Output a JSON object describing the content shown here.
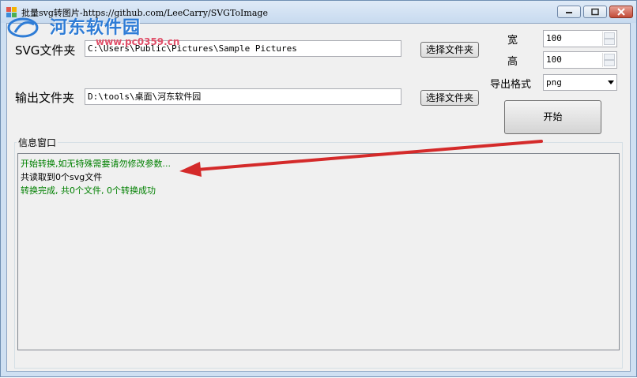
{
  "window": {
    "title": "批量svg转图片-https://github.com/LeeCarry/SVGToImage",
    "controls": {
      "minimize": "minimize",
      "maximize": "maximize",
      "close": "close"
    }
  },
  "watermark": {
    "text": "河东软件园",
    "url": "www.pc0359.cn"
  },
  "form": {
    "svg_folder": {
      "label": "SVG文件夹",
      "value": "C:\\Users\\Public\\Pictures\\Sample Pictures",
      "button": "选择文件夹"
    },
    "output_folder": {
      "label": "输出文件夹",
      "value": "D:\\tools\\桌面\\河东软件园",
      "button": "选择文件夹"
    },
    "width": {
      "label": "宽",
      "value": "100"
    },
    "height": {
      "label": "高",
      "value": "100"
    },
    "format": {
      "label": "导出格式",
      "value": "png"
    },
    "start_button": "开始"
  },
  "info_window": {
    "title": "信息窗口",
    "lines": [
      {
        "text": "开始转换,如无特殊需要请勿修改参数...",
        "color": "#008000"
      },
      {
        "text": "共读取到0个svg文件",
        "color": "#000000"
      },
      {
        "text": "转换完成, 共0个文件, 0个转换成功",
        "color": "#008000"
      }
    ]
  },
  "colors": {
    "annotation_arrow": "#d42a2a",
    "log_green": "#008000"
  }
}
